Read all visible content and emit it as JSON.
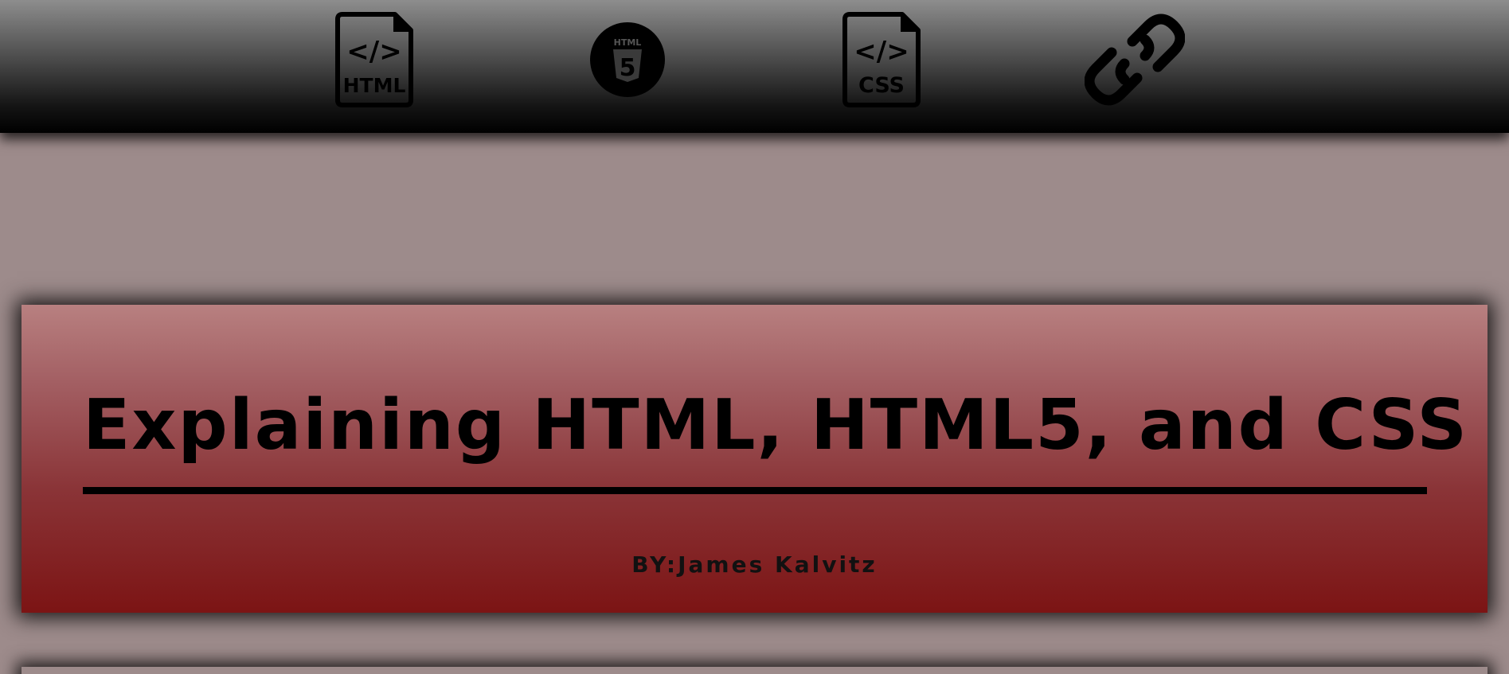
{
  "nav": {
    "items": [
      {
        "icon": "html-file-icon",
        "label": "HTML",
        "symbol": "</>"
      },
      {
        "icon": "html5-badge-icon",
        "label": "HTML",
        "number": "5"
      },
      {
        "icon": "css-file-icon",
        "label": "CSS",
        "symbol": "</>"
      },
      {
        "icon": "link-icon"
      }
    ]
  },
  "hero": {
    "title": "Explaining HTML, HTML5, and CSS",
    "byline": "BY:James Kalvitz"
  },
  "colors": {
    "page_background": "#9d8b8b",
    "navbar_top": "#8d8d8d",
    "navbar_bottom": "#000000",
    "hero_top": "#b88080",
    "hero_bottom": "#7c1414",
    "icon_color": "#000000"
  }
}
